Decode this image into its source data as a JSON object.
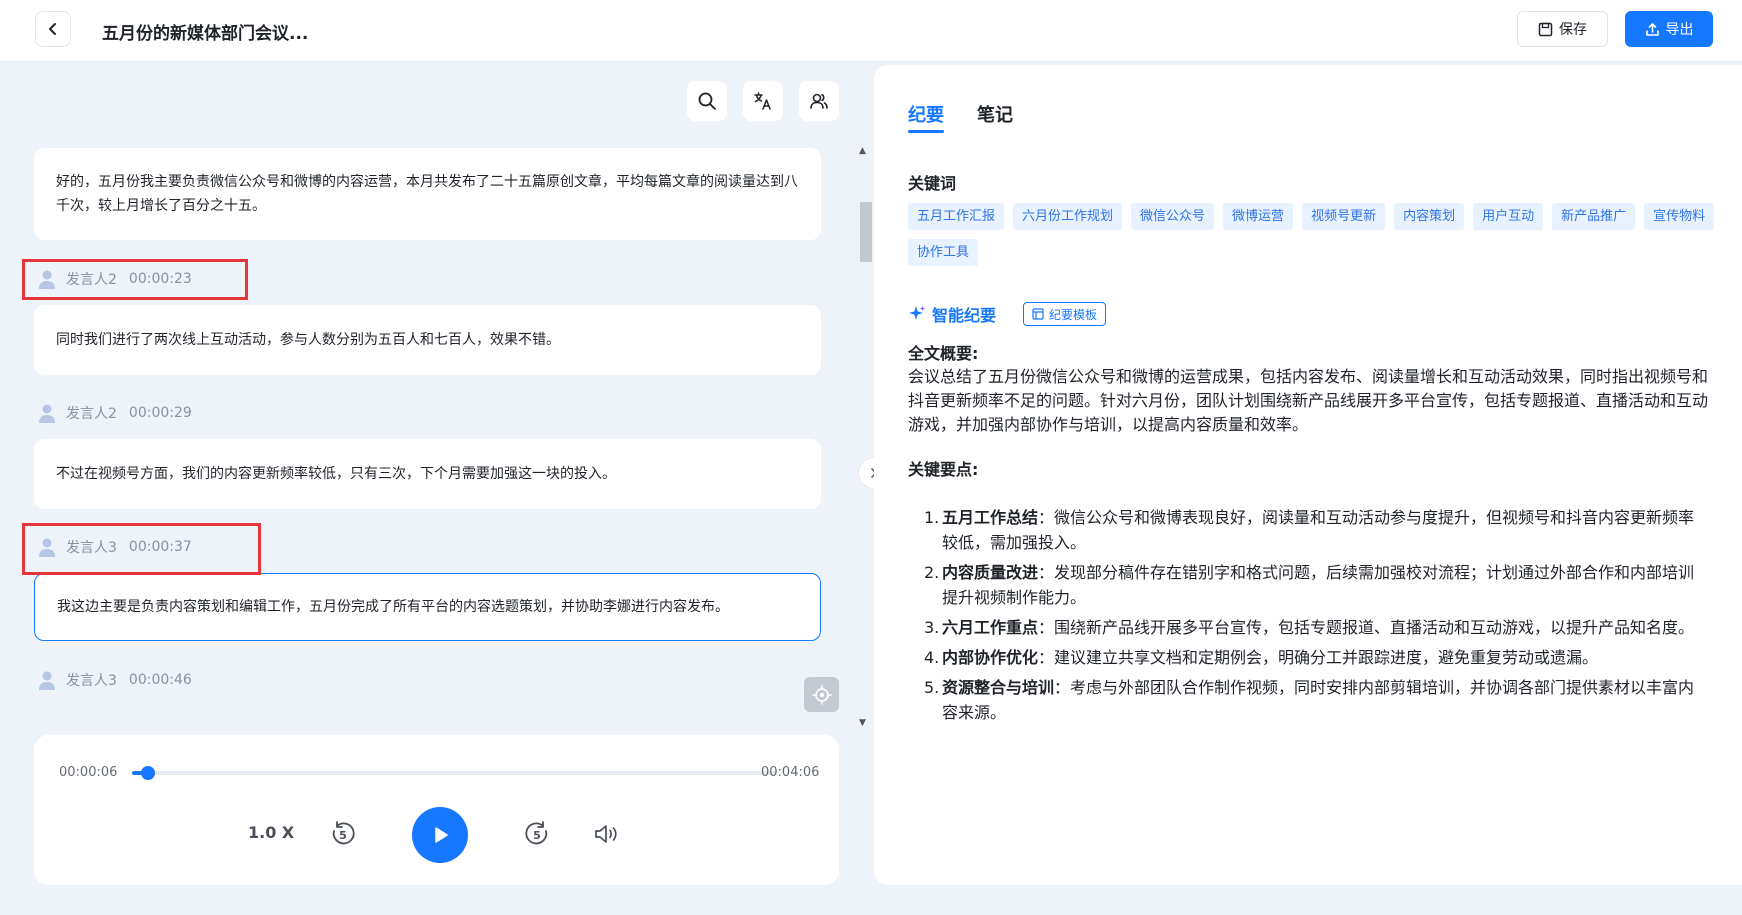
{
  "header": {
    "title": "五月份的新媒体部门会议...",
    "save_label": "保存",
    "export_label": "导出"
  },
  "transcript": {
    "entries": [
      {
        "text": "好的，五月份我主要负责微信公众号和微博的内容运营，本月共发布了二十五篇原创文章，平均每篇文章的阅读量达到八千次，较上月增长了百分之十五。"
      },
      {
        "speaker": "发言人2",
        "time": "00:00:23",
        "text": "同时我们进行了两次线上互动活动，参与人数分别为五百人和七百人，效果不错。"
      },
      {
        "speaker": "发言人2",
        "time": "00:00:29",
        "text": "不过在视频号方面，我们的内容更新频率较低，只有三次，下个月需要加强这一块的投入。"
      },
      {
        "speaker": "发言人3",
        "time": "00:00:37",
        "text": "我这边主要是负责内容策划和编辑工作，五月份完成了所有平台的内容选题策划，并协助李娜进行内容发布。"
      },
      {
        "speaker": "发言人3",
        "time": "00:00:46",
        "text": ""
      }
    ]
  },
  "player": {
    "current_time": "00:00:06",
    "total_time": "00:04:06",
    "progress": 0.024,
    "speed": "1.0 X",
    "skip_seconds": "5"
  },
  "right_panel": {
    "tabs": [
      "纪要",
      "笔记"
    ],
    "keywords_title": "关键词",
    "keywords": [
      "五月工作汇报",
      "六月份工作规划",
      "微信公众号",
      "微博运营",
      "视频号更新",
      "内容策划",
      "用户互动",
      "新产品推广",
      "宣传物料",
      "协作工具"
    ],
    "ai_title": "智能纪要",
    "template_label": "纪要模板",
    "summary_title": "全文概要:",
    "summary_text": "会议总结了五月份微信公众号和微博的运营成果，包括内容发布、阅读量增长和互动活动效果，同时指出视频号和抖音更新频率不足的问题。针对六月份，团队计划围绕新产品线展开多平台宣传，包括专题报道、直播活动和互动游戏，并加强内部协作与培训，以提高内容质量和效率。",
    "points_title": "关键要点:",
    "points": [
      {
        "num": "1.",
        "title": "五月工作总结",
        "text": "：微信公众号和微博表现良好，阅读量和互动活动参与度提升，但视频号和抖音内容更新频率较低，需加强投入。"
      },
      {
        "num": "2.",
        "title": "内容质量改进",
        "text": "：发现部分稿件存在错别字和格式问题，后续需加强校对流程；计划通过外部合作和内部培训提升视频制作能力。"
      },
      {
        "num": "3.",
        "title": "六月工作重点",
        "text": "：围绕新产品线开展多平台宣传，包括专题报道、直播活动和互动游戏，以提升产品知名度。"
      },
      {
        "num": "4.",
        "title": "内部协作优化",
        "text": "：建议建立共享文档和定期例会，明确分工并跟踪进度，避免重复劳动或遗漏。"
      },
      {
        "num": "5.",
        "title": "资源整合与培训",
        "text": "：考虑与外部团队合作制作视频，同时安排内部剪辑培训，并协调各部门提供素材以丰富内容来源。"
      }
    ]
  },
  "colors": {
    "accent": "#1677ff",
    "highlight": "#e5363c",
    "chip_bg": "#e8f1fe"
  }
}
